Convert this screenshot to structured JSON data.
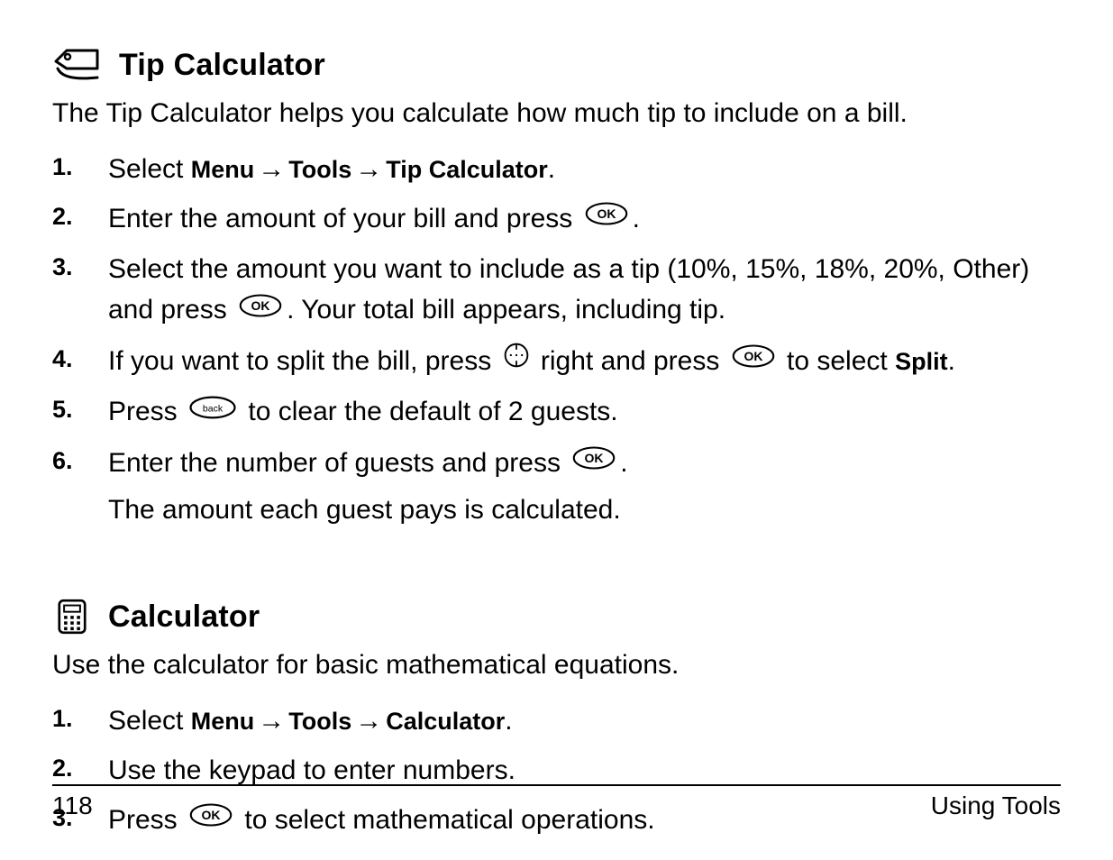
{
  "section1": {
    "title": "Tip Calculator",
    "intro": "The Tip Calculator helps you calculate how much tip to include on a bill.",
    "steps": {
      "s1": {
        "num": "1.",
        "prefix": "Select ",
        "m": "Menu",
        "a1": " → ",
        "t": "Tools",
        "a2": " → ",
        "c": "Tip Calculator",
        "suffix": "."
      },
      "s2": {
        "num": "2.",
        "prefix": "Enter the amount of your bill and press ",
        "suffix": "."
      },
      "s3": {
        "num": "3.",
        "prefix": "Select the amount you want to include as a tip (10%, 15%, 18%, 20%, Other) and press ",
        "suffix": ". Your total bill appears, including tip."
      },
      "s4": {
        "num": "4.",
        "p1": "If you want to split the bill, press ",
        "p2": " right and press ",
        "p3": " to select ",
        "split": "Split",
        "p4": "."
      },
      "s5": {
        "num": "5.",
        "p1": "Press ",
        "p2": " to clear the default of 2 guests."
      },
      "s6": {
        "num": "6.",
        "p1": "Enter the number of guests and press ",
        "p2": ".",
        "sub": "The amount each guest pays is calculated."
      }
    }
  },
  "section2": {
    "title": "Calculator",
    "intro": "Use the calculator for basic mathematical equations.",
    "steps": {
      "s1": {
        "num": "1.",
        "prefix": "Select ",
        "m": "Menu",
        "a1": " → ",
        "t": "Tools",
        "a2": " → ",
        "c": "Calculator",
        "suffix": "."
      },
      "s2": {
        "num": "2.",
        "text": "Use the keypad to enter numbers."
      },
      "s3": {
        "num": "3.",
        "p1": "Press ",
        "p2": " to select mathematical operations."
      }
    }
  },
  "footer": {
    "page": "118",
    "title": "Using Tools"
  }
}
